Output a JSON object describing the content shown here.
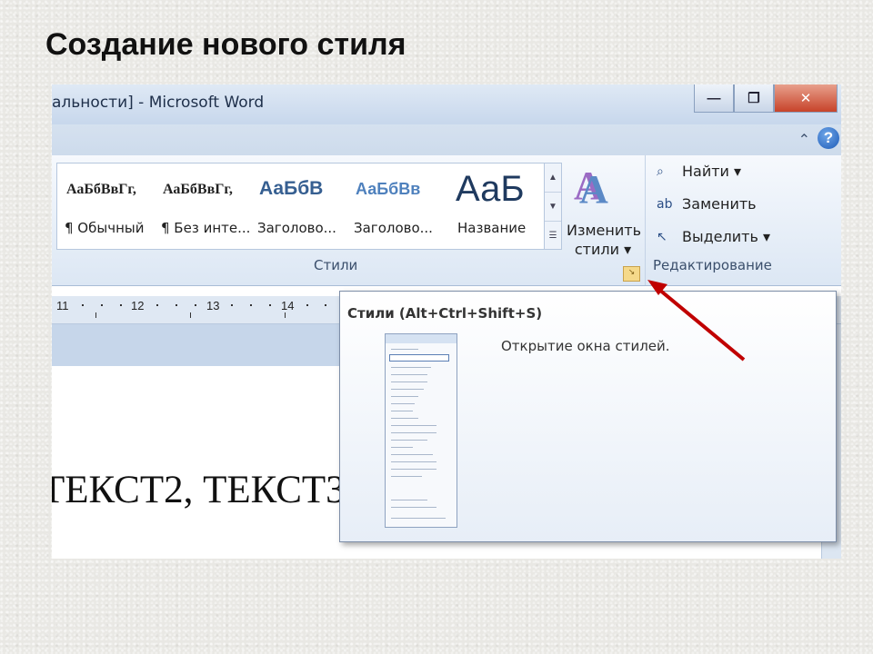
{
  "slide": {
    "title": "Создание нового стиля"
  },
  "window": {
    "title": "альности] - Microsoft Word",
    "minimize": "—",
    "restore": "❐",
    "close": "✕"
  },
  "ribbon": {
    "styles_group": {
      "label": "Стили",
      "tiles": [
        {
          "sample": "АаБбВвГг,",
          "name": "¶ Обычный"
        },
        {
          "sample": "АаБбВвГг,",
          "name": "¶ Без инте..."
        },
        {
          "sample": "АаБбВ",
          "name": "Заголово..."
        },
        {
          "sample": "АаБбВв",
          "name": "Заголово..."
        },
        {
          "sample": "АаБ",
          "name": "Название"
        }
      ],
      "change_styles": "Изменить стили ▾"
    },
    "editing_group": {
      "label": "Редактирование",
      "find": "Найти ▾",
      "replace": "Заменить",
      "select": "Выделить ▾"
    }
  },
  "ruler": {
    "numbers": [
      "11",
      "12",
      "13",
      "14"
    ]
  },
  "document": {
    "text": "ТЕКСТ2, ТЕКСТ3"
  },
  "tooltip": {
    "title": "Стили (Alt+Ctrl+Shift+S)",
    "description": "Открытие окна стилей."
  },
  "colors": {
    "accent": "#4f81bd",
    "arrow": "#c00000"
  }
}
